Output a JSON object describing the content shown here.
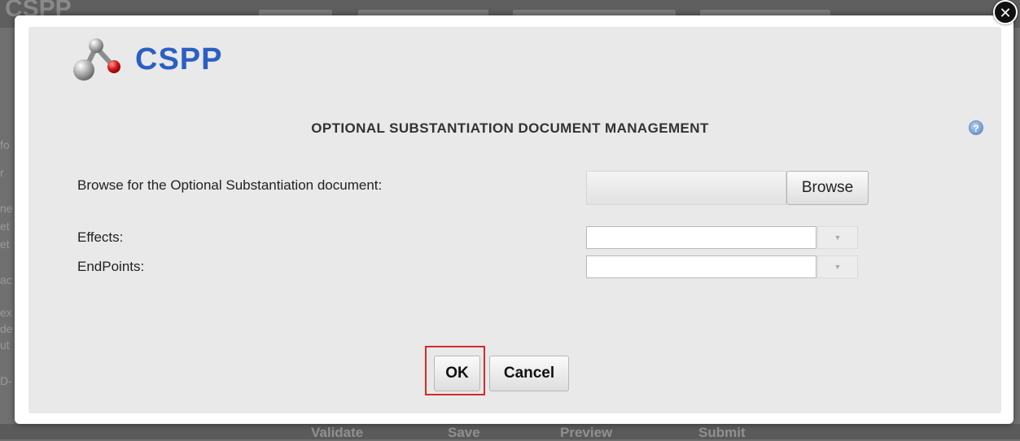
{
  "background": {
    "logo_text": "CSPP",
    "bottom_buttons": [
      "Validate",
      "Save",
      "Preview",
      "Submit"
    ],
    "edge_fragments": [
      "fo",
      "r",
      "ne",
      "et",
      "et",
      "ac",
      "ex",
      "de",
      "ut",
      "D-"
    ]
  },
  "dialog": {
    "close_symbol": "✕",
    "logo_text": "CSPP",
    "help_symbol": "?",
    "title": "OPTIONAL SUBSTANTIATION DOCUMENT MANAGEMENT",
    "browse_label": "Browse for the Optional Substantiation document:",
    "browse_button": "Browse",
    "effects_label": "Effects:",
    "effects_value": "",
    "endpoints_label": "EndPoints:",
    "endpoints_value": "",
    "dropdown_arrow": "▼",
    "ok_button": "OK",
    "cancel_button": "Cancel"
  },
  "colors": {
    "logo_blue": "#2b5fc4",
    "highlight_red": "#d22b2b",
    "dialog_panel": "#e9e9e9",
    "overlay_gray": "#707070"
  },
  "icons": {
    "logo": "molecule-icon",
    "close": "close-icon",
    "help": "help-icon",
    "dropdown": "chevron-down-icon"
  }
}
